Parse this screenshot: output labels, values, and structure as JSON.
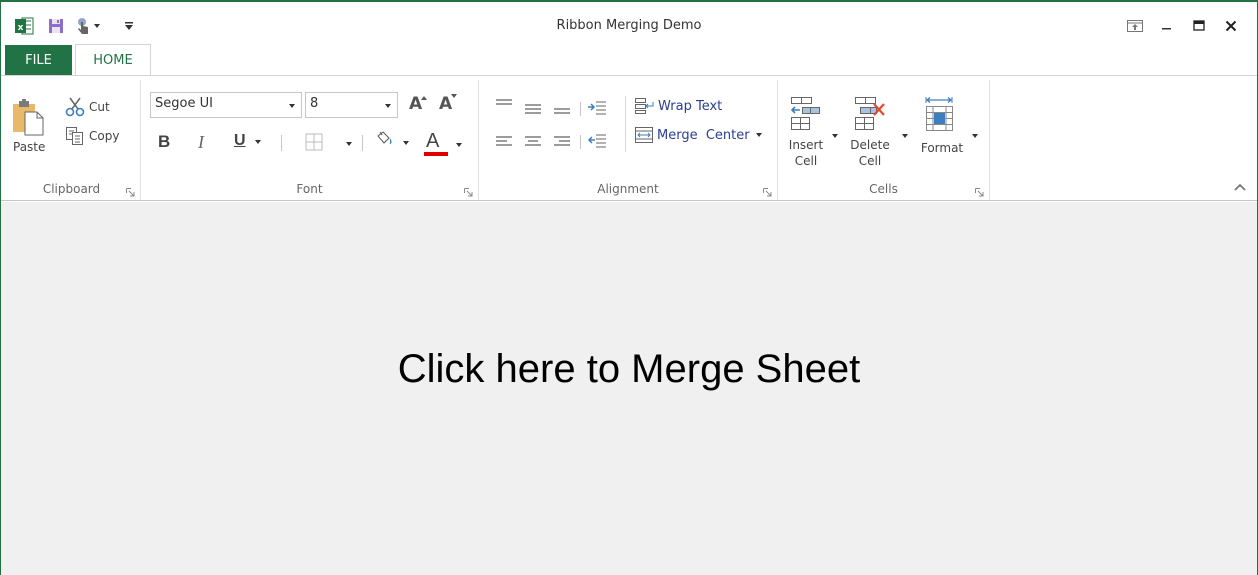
{
  "window": {
    "title": "Ribbon Merging Demo",
    "accent_color": "#217346"
  },
  "quick_access": {
    "items": [
      {
        "name": "excel-logo",
        "icon": "excel-icon"
      },
      {
        "name": "save",
        "icon": "save-icon"
      },
      {
        "name": "touch-mode",
        "icon": "touch-icon"
      },
      {
        "name": "customize",
        "icon": "customize-qat-icon"
      }
    ]
  },
  "window_controls": {
    "ribbon_display": "ribbon-display-options-icon",
    "minimize": "minimize-icon",
    "maximize": "maximize-icon",
    "close": "close-icon"
  },
  "tabs": [
    {
      "label": "FILE",
      "active": false
    },
    {
      "label": "HOME",
      "active": true
    }
  ],
  "ribbon": {
    "clipboard": {
      "label": "Clipboard",
      "paste": "Paste",
      "cut": "Cut",
      "copy": "Copy"
    },
    "font": {
      "label": "Font",
      "font_name": "Segoe UI",
      "font_size": "8",
      "bold": "B",
      "italic": "I",
      "underline": "U",
      "font_color_letter": "A",
      "font_color": "#e00000",
      "grow": "A",
      "shrink": "A"
    },
    "alignment": {
      "label": "Alignment",
      "wrap_text": "Wrap Text",
      "merge_center": "Merge  Center"
    },
    "cells": {
      "label": "Cells",
      "insert": [
        "Insert",
        "Cell"
      ],
      "delete": [
        "Delete",
        "Cell"
      ],
      "format": "Format"
    }
  },
  "content": {
    "merge_prompt": "Click here to Merge Sheet",
    "background": "#f0f0f0"
  }
}
